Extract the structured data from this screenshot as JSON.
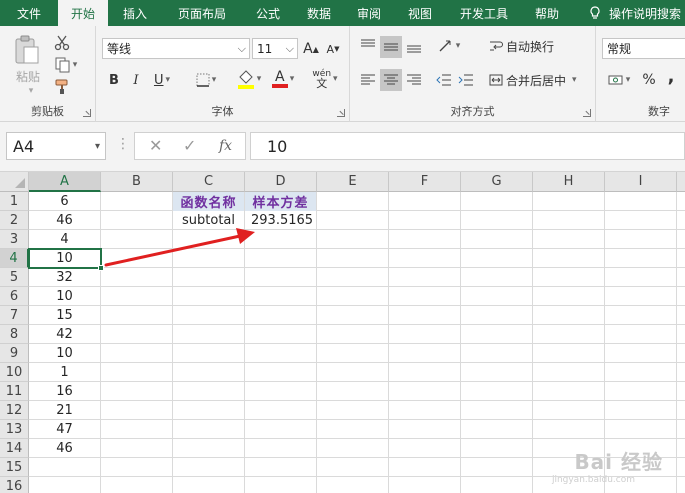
{
  "tabs": [
    {
      "label": "文件",
      "active": false
    },
    {
      "label": "开始",
      "active": true
    },
    {
      "label": "插入",
      "active": false
    },
    {
      "label": "页面布局",
      "active": false
    },
    {
      "label": "公式",
      "active": false
    },
    {
      "label": "数据",
      "active": false
    },
    {
      "label": "审阅",
      "active": false
    },
    {
      "label": "视图",
      "active": false
    },
    {
      "label": "开发工具",
      "active": false
    },
    {
      "label": "帮助",
      "active": false
    }
  ],
  "tell_me": "操作说明搜索",
  "ribbon": {
    "clipboard": {
      "label": "剪贴板",
      "paste_label": "粘贴"
    },
    "font": {
      "label": "字体",
      "font_name": "等线",
      "font_size": "11",
      "bold": "B",
      "italic": "I",
      "underline": "U",
      "grow": "A",
      "shrink": "A",
      "font_color_letter": "A",
      "phonetic": "wén"
    },
    "alignment": {
      "label": "对齐方式",
      "wrap_text": "自动换行",
      "merge_center": "合并后居中"
    },
    "number": {
      "label": "数字",
      "format": "常规",
      "percent": "%",
      "comma": ","
    }
  },
  "formula_bar": {
    "name_box": "A4",
    "cancel": "✕",
    "enter": "✓",
    "fx": "fx",
    "value": "10"
  },
  "columns": [
    "A",
    "B",
    "C",
    "D",
    "E",
    "F",
    "G",
    "H",
    "I"
  ],
  "rows": [
    "1",
    "2",
    "3",
    "4",
    "5",
    "6",
    "7",
    "8",
    "9",
    "10",
    "11",
    "12",
    "13",
    "14",
    "15",
    "16"
  ],
  "column_a": [
    "6",
    "46",
    "4",
    "10",
    "32",
    "10",
    "15",
    "42",
    "10",
    "1",
    "16",
    "21",
    "47",
    "46"
  ],
  "table": {
    "header_func": "函数名称",
    "header_var": "样本方差",
    "func": "subtotal",
    "result": "293.5165"
  },
  "active_cell": "A4",
  "watermark": {
    "main": "Bai 经验",
    "sub": "jingyan.baidu.com"
  },
  "colors": {
    "excel_green": "#217346",
    "header_fill": "#dce6f1",
    "header_text": "#7030a0",
    "arrow": "#e02020"
  }
}
